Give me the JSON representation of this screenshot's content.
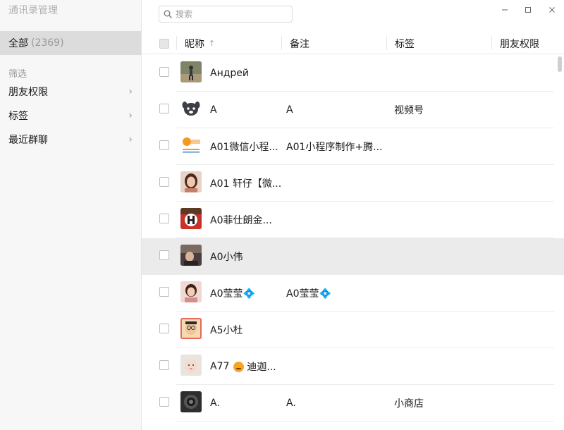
{
  "window": {
    "title": "通讯录管理",
    "controls": [
      "minimize",
      "maximize",
      "close"
    ]
  },
  "sidebar": {
    "all_label": "全部",
    "all_count": "(2369)",
    "filter_heading": "筛选",
    "filters": [
      {
        "label": "朋友权限"
      },
      {
        "label": "标签"
      },
      {
        "label": "最近群聊"
      }
    ]
  },
  "search": {
    "placeholder": "搜索",
    "value": ""
  },
  "table": {
    "columns": [
      "昵称",
      "备注",
      "标签",
      "朋友权限"
    ],
    "sort_indicator": "↑",
    "rows": [
      {
        "name": "Андрей",
        "remark": "",
        "tag": "",
        "avatar": "photo-runner",
        "bg": "#6b6f5c"
      },
      {
        "name": "A",
        "remark": "A",
        "tag": "视频号",
        "avatar": "cartoon-dog",
        "bg": "#ffffff"
      },
      {
        "name": "A01微信小程...",
        "remark": "A01小程序制作+腾...",
        "tag": "",
        "avatar": "logo-orange",
        "bg": "#ffffff"
      },
      {
        "name": "A01 轩仔【微...",
        "remark": "",
        "tag": "",
        "avatar": "photo-woman",
        "bg": "#c89a84"
      },
      {
        "name": "A0菲仕朗金...",
        "remark": "",
        "tag": "",
        "avatar": "logo-red-h",
        "bg": "#b8372d"
      },
      {
        "name": "A0小伟",
        "remark": "",
        "tag": "",
        "avatar": "photo-dark",
        "bg": "#4b4040",
        "highlight": true
      },
      {
        "name": "A0莹莹💠",
        "remark": "A0莹莹💠",
        "tag": "",
        "avatar": "photo-woman-2",
        "bg": "#d9a897"
      },
      {
        "name": "A5小杜",
        "remark": "",
        "tag": "",
        "avatar": "photo-child",
        "bg": "#e0a073"
      },
      {
        "name": "A77",
        "name_suffix": "迪迦...",
        "remark": "",
        "tag": "",
        "avatar": "photo-baby",
        "bg": "#d8d0c6"
      },
      {
        "name": "A.",
        "remark": "A.",
        "tag": "小商店",
        "avatar": "photo-camera",
        "bg": "#3a3a3a"
      }
    ]
  },
  "icons": {
    "search": "search-icon",
    "chevron": "chevron-right-icon"
  }
}
